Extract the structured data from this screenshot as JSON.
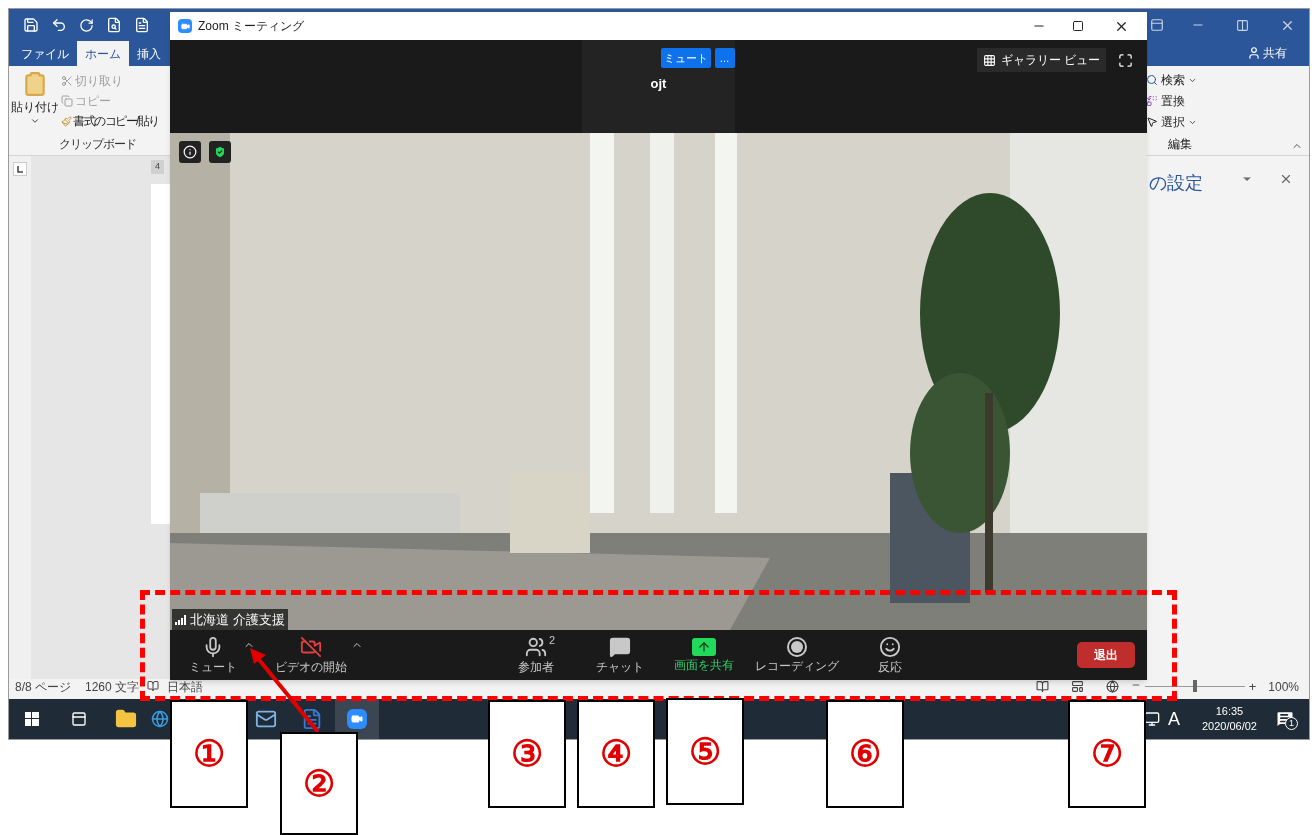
{
  "word": {
    "tabs": [
      {
        "label": "ファイル",
        "selected": false
      },
      {
        "label": "ホーム",
        "selected": true
      },
      {
        "label": "挿入",
        "selected": false
      }
    ],
    "share": "共有",
    "clipboard": {
      "paste": "貼り付け",
      "cut": "切り取り",
      "copy": "コピー",
      "format_painter": "書式のコピー/貼り",
      "group": "クリップボード"
    },
    "editing": {
      "find": "検索",
      "replace": "置換",
      "select": "選択",
      "group": "編集"
    },
    "ruler_mark": "4",
    "pane_title": "の設定",
    "status_bar": {
      "page": "8/8 ページ",
      "words": "1260 文字",
      "language": "日本語",
      "zoom_slider": {
        "level": 0.5
      },
      "zoom_in": "+",
      "zoom": "100%"
    }
  },
  "zoom_window": {
    "title": "Zoom ミーティング",
    "tile": {
      "name": "ojt",
      "mute_button": "ミュート",
      "more_button": "…"
    },
    "gallery_view": "ギャラリー ビュー",
    "video": {
      "kind": "picture",
      "participant": "北海道 介護支援"
    },
    "toolbar": [
      {
        "kind": "mic",
        "label": "ミュート"
      },
      {
        "kind": "video",
        "label": "ビデオの開始"
      },
      {
        "kind": "participants",
        "label": "参加者",
        "count": "2"
      },
      {
        "kind": "chat",
        "label": "チャット"
      },
      {
        "kind": "share",
        "label": "画面を共有"
      },
      {
        "kind": "record",
        "label": "レコーディング"
      },
      {
        "kind": "reactions",
        "label": "反応"
      }
    ],
    "leave": "退出"
  },
  "taskbar": {
    "input_mode": "A",
    "time": "16:35",
    "date": "2020/06/02",
    "notifications": "1"
  },
  "callouts": [
    "①",
    "②",
    "③",
    "④",
    "⑤",
    "⑥",
    "⑦"
  ]
}
